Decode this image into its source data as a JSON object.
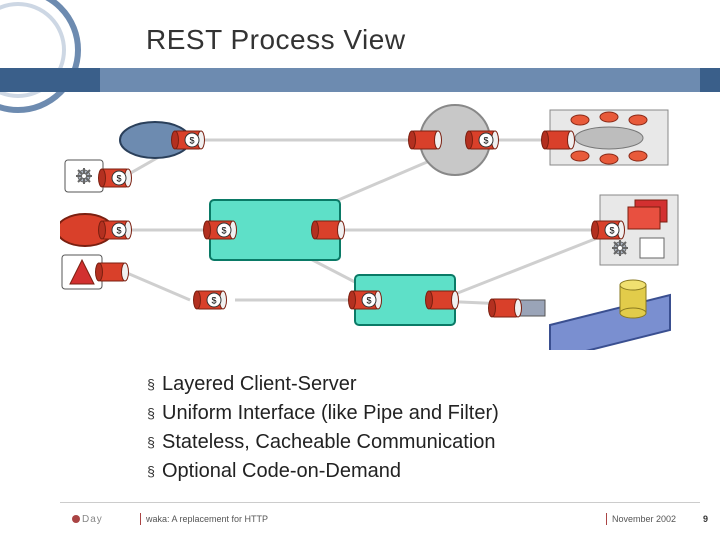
{
  "title": "REST Process View",
  "bullets": [
    "Layered Client-Server",
    "Uniform Interface (like Pipe and Filter)",
    "Stateless, Cacheable Communication",
    "Optional Code-on-Demand"
  ],
  "footer": {
    "logo_text": "Day",
    "left": "waka: A replacement for HTTP",
    "right": "November 2002",
    "page": "9"
  },
  "diagram": {
    "description": "REST process view: multiple client agents on the left (with optional cached '$' connectors) communicating via uniform pipe-and-filter intermediaries (teal boxes with '$' connectors) to layered servers on the right — a grey proxy/gateway circle, an origin server cluster (orange spokes), a component server (red boxes + gear), and a data store (yellow cylinder on blue platform).",
    "node_symbol": "$",
    "colors": {
      "connector": "#d9402a",
      "client_ellipse": "#6d8bb0",
      "intermediary_box": "#5ee0c8",
      "proxy_circle": "#c8c8c8",
      "server_box": "#e8e8e8",
      "data_platform": "#7a8fd0",
      "data_cylinder": "#e2cc4a",
      "orc_node": "#e85a3a",
      "comp_red": "#d23030"
    }
  }
}
